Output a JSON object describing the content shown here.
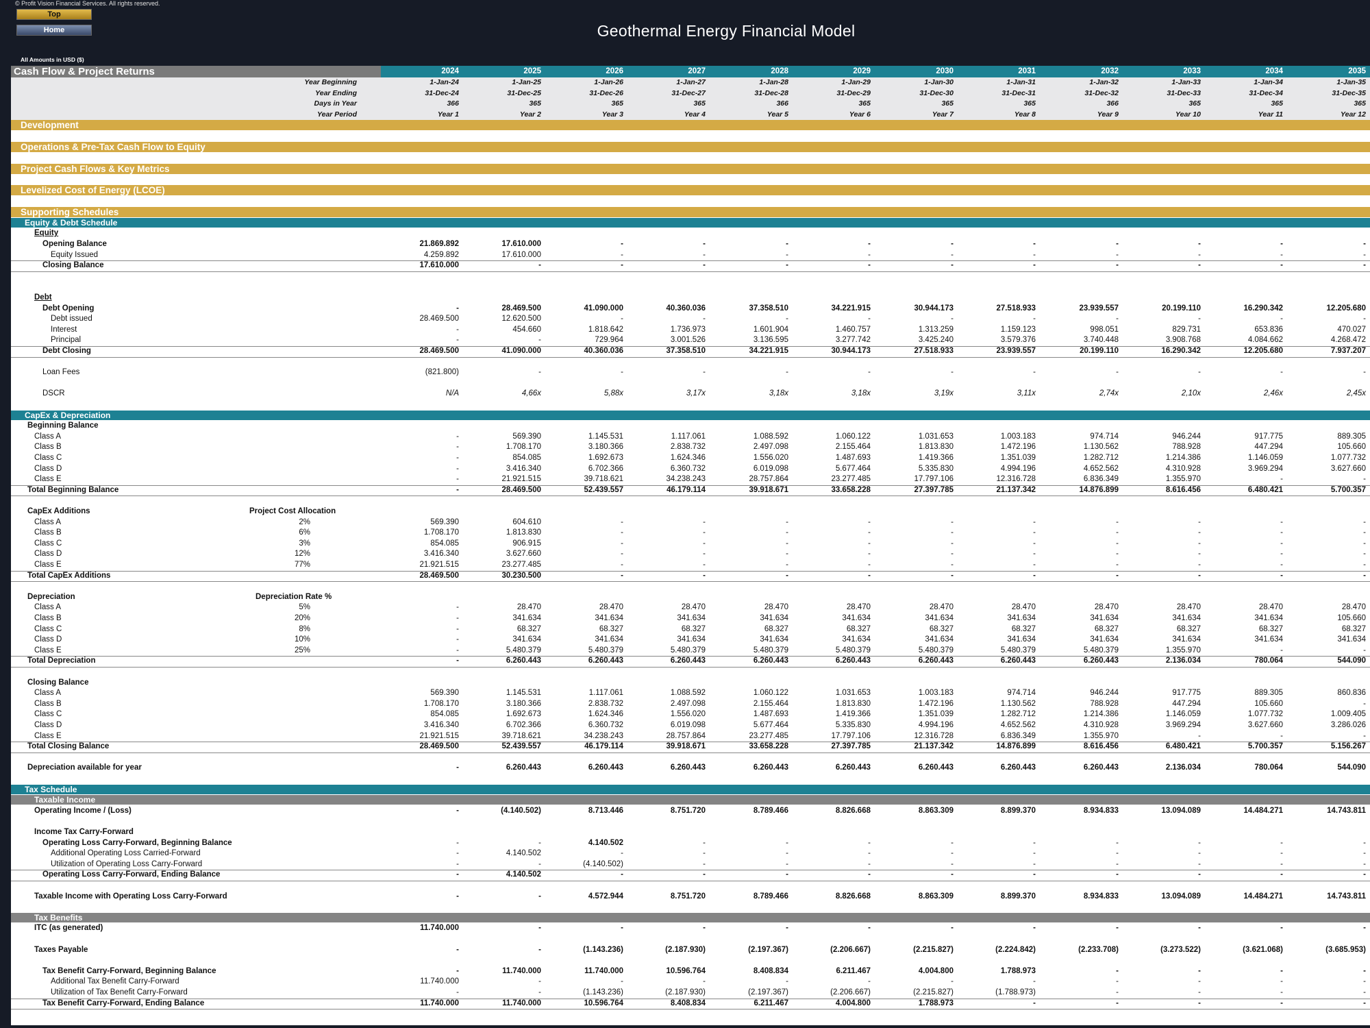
{
  "app": {
    "copyright": "© Profit Vision Financial Services. All rights reserved.",
    "top_label": "Top",
    "home_label": "Home",
    "title": "Geothermal Energy Financial Model",
    "amounts_note": "All Amounts in  USD ($)"
  },
  "header": {
    "title": "Cash Flow & Project Returns",
    "years": [
      "2024",
      "2025",
      "2026",
      "2027",
      "2028",
      "2029",
      "2030",
      "2031",
      "2032",
      "2033",
      "2034",
      "2035"
    ]
  },
  "rows": [
    {
      "type": "meta",
      "label": "Year Beginning",
      "vals": [
        "1-Jan-24",
        "1-Jan-25",
        "1-Jan-26",
        "1-Jan-27",
        "1-Jan-28",
        "1-Jan-29",
        "1-Jan-30",
        "1-Jan-31",
        "1-Jan-32",
        "1-Jan-33",
        "1-Jan-34",
        "1-Jan-35"
      ]
    },
    {
      "type": "meta",
      "label": "Year Ending",
      "vals": [
        "31-Dec-24",
        "31-Dec-25",
        "31-Dec-26",
        "31-Dec-27",
        "31-Dec-28",
        "31-Dec-29",
        "31-Dec-30",
        "31-Dec-31",
        "31-Dec-32",
        "31-Dec-33",
        "31-Dec-34",
        "31-Dec-35"
      ]
    },
    {
      "type": "meta",
      "label": "Days in Year",
      "vals": [
        "366",
        "365",
        "365",
        "365",
        "366",
        "365",
        "365",
        "365",
        "366",
        "365",
        "365",
        "365"
      ]
    },
    {
      "type": "meta",
      "label": "Year Period",
      "vals": [
        "Year 1",
        "Year 2",
        "Year 3",
        "Year 4",
        "Year 5",
        "Year 6",
        "Year 7",
        "Year 8",
        "Year 9",
        "Year 10",
        "Year 11",
        "Year 12"
      ]
    },
    {
      "type": "gold",
      "label": "Development"
    },
    {
      "type": "gap"
    },
    {
      "type": "gold",
      "label": "Operations & Pre-Tax Cash Flow to Equity"
    },
    {
      "type": "gap"
    },
    {
      "type": "gold",
      "label": "Project Cash Flows & Key Metrics"
    },
    {
      "type": "gap"
    },
    {
      "type": "gold",
      "label": "Levelized Cost of Energy (LCOE)"
    },
    {
      "type": "gap"
    },
    {
      "type": "gold",
      "label": "Supporting Schedules"
    },
    {
      "type": "teal",
      "label": "Equity & Debt Schedule"
    },
    {
      "type": "text",
      "label": "Equity",
      "x": 34,
      "b": true,
      "u": true
    },
    {
      "type": "data",
      "label": "Opening Balance",
      "x": 46,
      "b": true,
      "vals": [
        "21.869.892",
        "17.610.000",
        "-",
        "-",
        "-",
        "-",
        "-",
        "-",
        "-",
        "-",
        "-",
        "-"
      ]
    },
    {
      "type": "data",
      "label": "Equity Issued",
      "x": 58,
      "vals": [
        "4.259.892",
        "17.610.000",
        "-",
        "-",
        "-",
        "-",
        "-",
        "-",
        "-",
        "-",
        "-",
        "-"
      ]
    },
    {
      "type": "data",
      "label": "Closing Balance",
      "x": 46,
      "b": true,
      "bt": true,
      "vals": [
        "17.610.000",
        "-",
        "-",
        "-",
        "-",
        "-",
        "-",
        "-",
        "-",
        "-",
        "-",
        "-"
      ]
    },
    {
      "type": "gap"
    },
    {
      "type": "gap"
    },
    {
      "type": "text",
      "label": "Debt",
      "x": 34,
      "b": true,
      "u": true
    },
    {
      "type": "data",
      "label": "Debt Opening",
      "x": 46,
      "b": true,
      "vals": [
        "-",
        "28.469.500",
        "41.090.000",
        "40.360.036",
        "37.358.510",
        "34.221.915",
        "30.944.173",
        "27.518.933",
        "23.939.557",
        "20.199.110",
        "16.290.342",
        "12.205.680"
      ]
    },
    {
      "type": "data",
      "label": "Debt issued",
      "x": 58,
      "vals": [
        "28.469.500",
        "12.620.500",
        "-",
        "-",
        "-",
        "-",
        "-",
        "-",
        "-",
        "-",
        "-",
        "-"
      ]
    },
    {
      "type": "data",
      "label": "Interest",
      "x": 58,
      "vals": [
        "-",
        "454.660",
        "1.818.642",
        "1.736.973",
        "1.601.904",
        "1.460.757",
        "1.313.259",
        "1.159.123",
        "998.051",
        "829.731",
        "653.836",
        "470.027"
      ]
    },
    {
      "type": "data",
      "label": "Principal",
      "x": 58,
      "vals": [
        "-",
        "-",
        "729.964",
        "3.001.526",
        "3.136.595",
        "3.277.742",
        "3.425.240",
        "3.579.376",
        "3.740.448",
        "3.908.768",
        "4.084.662",
        "4.268.472"
      ]
    },
    {
      "type": "data",
      "label": "Debt Closing",
      "x": 46,
      "b": true,
      "bt": true,
      "vals": [
        "28.469.500",
        "41.090.000",
        "40.360.036",
        "37.358.510",
        "34.221.915",
        "30.944.173",
        "27.518.933",
        "23.939.557",
        "20.199.110",
        "16.290.342",
        "12.205.680",
        "7.937.207"
      ]
    },
    {
      "type": "gap"
    },
    {
      "type": "data",
      "label": "Loan Fees",
      "x": 46,
      "vals": [
        "(821.800)",
        "-",
        "-",
        "-",
        "-",
        "-",
        "-",
        "-",
        "-",
        "-",
        "-",
        "-"
      ]
    },
    {
      "type": "gap"
    },
    {
      "type": "data",
      "label": "DSCR",
      "x": 46,
      "i": true,
      "vals": [
        "N/A",
        "4,66x",
        "5,88x",
        "3,17x",
        "3,18x",
        "3,18x",
        "3,19x",
        "3,11x",
        "2,74x",
        "2,10x",
        "2,46x",
        "2,45x"
      ]
    },
    {
      "type": "gap"
    },
    {
      "type": "teal",
      "label": "CapEx & Depreciation"
    },
    {
      "type": "text",
      "label": "Beginning Balance",
      "x": 24,
      "b": true
    },
    {
      "type": "data",
      "label": "Class A",
      "x": 34,
      "vals": [
        "-",
        "569.390",
        "1.145.531",
        "1.117.061",
        "1.088.592",
        "1.060.122",
        "1.031.653",
        "1.003.183",
        "974.714",
        "946.244",
        "917.775",
        "889.305"
      ]
    },
    {
      "type": "data",
      "label": "Class B",
      "x": 34,
      "vals": [
        "-",
        "1.708.170",
        "3.180.366",
        "2.838.732",
        "2.497.098",
        "2.155.464",
        "1.813.830",
        "1.472.196",
        "1.130.562",
        "788.928",
        "447.294",
        "105.660"
      ]
    },
    {
      "type": "data",
      "label": "Class C",
      "x": 34,
      "vals": [
        "-",
        "854.085",
        "1.692.673",
        "1.624.346",
        "1.556.020",
        "1.487.693",
        "1.419.366",
        "1.351.039",
        "1.282.712",
        "1.214.386",
        "1.146.059",
        "1.077.732"
      ]
    },
    {
      "type": "data",
      "label": "Class D",
      "x": 34,
      "vals": [
        "-",
        "3.416.340",
        "6.702.366",
        "6.360.732",
        "6.019.098",
        "5.677.464",
        "5.335.830",
        "4.994.196",
        "4.652.562",
        "4.310.928",
        "3.969.294",
        "3.627.660"
      ]
    },
    {
      "type": "data",
      "label": "Class E",
      "x": 34,
      "vals": [
        "-",
        "21.921.515",
        "39.718.621",
        "34.238.243",
        "28.757.864",
        "23.277.485",
        "17.797.106",
        "12.316.728",
        "6.836.349",
        "1.355.970",
        "-",
        "-"
      ]
    },
    {
      "type": "data",
      "label": "Total Beginning Balance",
      "x": 24,
      "b": true,
      "bt": true,
      "vals": [
        "-",
        "28.469.500",
        "52.439.557",
        "46.179.114",
        "39.918.671",
        "33.658.228",
        "27.397.785",
        "21.137.342",
        "14.876.899",
        "8.616.456",
        "6.480.421",
        "5.700.357"
      ]
    },
    {
      "type": "gap"
    },
    {
      "type": "pct",
      "label": "CapEx Additions",
      "x": 24,
      "b": true,
      "mid": "Project Cost Allocation",
      "midb": true
    },
    {
      "type": "data",
      "label": "Class A",
      "x": 34,
      "mid": "2%",
      "vals": [
        "569.390",
        "604.610",
        "-",
        "-",
        "-",
        "-",
        "-",
        "-",
        "-",
        "-",
        "-",
        "-"
      ]
    },
    {
      "type": "data",
      "label": "Class B",
      "x": 34,
      "mid": "6%",
      "vals": [
        "1.708.170",
        "1.813.830",
        "-",
        "-",
        "-",
        "-",
        "-",
        "-",
        "-",
        "-",
        "-",
        "-"
      ]
    },
    {
      "type": "data",
      "label": "Class C",
      "x": 34,
      "mid": "3%",
      "vals": [
        "854.085",
        "906.915",
        "-",
        "-",
        "-",
        "-",
        "-",
        "-",
        "-",
        "-",
        "-",
        "-"
      ]
    },
    {
      "type": "data",
      "label": "Class D",
      "x": 34,
      "mid": "12%",
      "vals": [
        "3.416.340",
        "3.627.660",
        "-",
        "-",
        "-",
        "-",
        "-",
        "-",
        "-",
        "-",
        "-",
        "-"
      ]
    },
    {
      "type": "data",
      "label": "Class E",
      "x": 34,
      "mid": "77%",
      "vals": [
        "21.921.515",
        "23.277.485",
        "-",
        "-",
        "-",
        "-",
        "-",
        "-",
        "-",
        "-",
        "-",
        "-"
      ]
    },
    {
      "type": "data",
      "label": "Total CapEx Additions",
      "x": 24,
      "b": true,
      "bt": true,
      "vals": [
        "28.469.500",
        "30.230.500",
        "-",
        "-",
        "-",
        "-",
        "-",
        "-",
        "-",
        "-",
        "-",
        "-"
      ]
    },
    {
      "type": "gap"
    },
    {
      "type": "pct",
      "label": "Depreciation",
      "x": 24,
      "b": true,
      "mid": "Depreciation Rate %",
      "midb": true
    },
    {
      "type": "data",
      "label": "Class A",
      "x": 34,
      "mid": "5%",
      "vals": [
        "-",
        "28.470",
        "28.470",
        "28.470",
        "28.470",
        "28.470",
        "28.470",
        "28.470",
        "28.470",
        "28.470",
        "28.470",
        "28.470"
      ]
    },
    {
      "type": "data",
      "label": "Class B",
      "x": 34,
      "mid": "20%",
      "vals": [
        "-",
        "341.634",
        "341.634",
        "341.634",
        "341.634",
        "341.634",
        "341.634",
        "341.634",
        "341.634",
        "341.634",
        "341.634",
        "105.660"
      ]
    },
    {
      "type": "data",
      "label": "Class C",
      "x": 34,
      "mid": "8%",
      "vals": [
        "-",
        "68.327",
        "68.327",
        "68.327",
        "68.327",
        "68.327",
        "68.327",
        "68.327",
        "68.327",
        "68.327",
        "68.327",
        "68.327"
      ]
    },
    {
      "type": "data",
      "label": "Class D",
      "x": 34,
      "mid": "10%",
      "vals": [
        "-",
        "341.634",
        "341.634",
        "341.634",
        "341.634",
        "341.634",
        "341.634",
        "341.634",
        "341.634",
        "341.634",
        "341.634",
        "341.634"
      ]
    },
    {
      "type": "data",
      "label": "Class E",
      "x": 34,
      "mid": "25%",
      "vals": [
        "-",
        "5.480.379",
        "5.480.379",
        "5.480.379",
        "5.480.379",
        "5.480.379",
        "5.480.379",
        "5.480.379",
        "5.480.379",
        "1.355.970",
        "-",
        "-"
      ]
    },
    {
      "type": "data",
      "label": "Total Depreciation",
      "x": 24,
      "b": true,
      "bt": true,
      "vals": [
        "-",
        "6.260.443",
        "6.260.443",
        "6.260.443",
        "6.260.443",
        "6.260.443",
        "6.260.443",
        "6.260.443",
        "6.260.443",
        "2.136.034",
        "780.064",
        "544.090"
      ]
    },
    {
      "type": "gap"
    },
    {
      "type": "text",
      "label": "Closing Balance",
      "x": 24,
      "b": true
    },
    {
      "type": "data",
      "label": "Class A",
      "x": 34,
      "vals": [
        "569.390",
        "1.145.531",
        "1.117.061",
        "1.088.592",
        "1.060.122",
        "1.031.653",
        "1.003.183",
        "974.714",
        "946.244",
        "917.775",
        "889.305",
        "860.836"
      ]
    },
    {
      "type": "data",
      "label": "Class B",
      "x": 34,
      "vals": [
        "1.708.170",
        "3.180.366",
        "2.838.732",
        "2.497.098",
        "2.155.464",
        "1.813.830",
        "1.472.196",
        "1.130.562",
        "788.928",
        "447.294",
        "105.660",
        "-"
      ]
    },
    {
      "type": "data",
      "label": "Class C",
      "x": 34,
      "vals": [
        "854.085",
        "1.692.673",
        "1.624.346",
        "1.556.020",
        "1.487.693",
        "1.419.366",
        "1.351.039",
        "1.282.712",
        "1.214.386",
        "1.146.059",
        "1.077.732",
        "1.009.405"
      ]
    },
    {
      "type": "data",
      "label": "Class D",
      "x": 34,
      "vals": [
        "3.416.340",
        "6.702.366",
        "6.360.732",
        "6.019.098",
        "5.677.464",
        "5.335.830",
        "4.994.196",
        "4.652.562",
        "4.310.928",
        "3.969.294",
        "3.627.660",
        "3.286.026"
      ]
    },
    {
      "type": "data",
      "label": "Class E",
      "x": 34,
      "vals": [
        "21.921.515",
        "39.718.621",
        "34.238.243",
        "28.757.864",
        "23.277.485",
        "17.797.106",
        "12.316.728",
        "6.836.349",
        "1.355.970",
        "-",
        "-",
        "-"
      ]
    },
    {
      "type": "data",
      "label": "Total Closing Balance",
      "x": 24,
      "b": true,
      "bt": true,
      "vals": [
        "28.469.500",
        "52.439.557",
        "46.179.114",
        "39.918.671",
        "33.658.228",
        "27.397.785",
        "21.137.342",
        "14.876.899",
        "8.616.456",
        "6.480.421",
        "5.700.357",
        "5.156.267"
      ]
    },
    {
      "type": "gap"
    },
    {
      "type": "data",
      "label": "Depreciation available for year",
      "x": 24,
      "b": true,
      "vals": [
        "-",
        "6.260.443",
        "6.260.443",
        "6.260.443",
        "6.260.443",
        "6.260.443",
        "6.260.443",
        "6.260.443",
        "6.260.443",
        "2.136.034",
        "780.064",
        "544.090"
      ]
    },
    {
      "type": "gap"
    },
    {
      "type": "teal",
      "label": "Tax Schedule"
    },
    {
      "type": "grey",
      "label": "Taxable Income"
    },
    {
      "type": "data",
      "label": "Operating Income / (Loss)",
      "x": 34,
      "b": true,
      "vals": [
        "-",
        "(4.140.502)",
        "8.713.446",
        "8.751.720",
        "8.789.466",
        "8.826.668",
        "8.863.309",
        "8.899.370",
        "8.934.833",
        "13.094.089",
        "14.484.271",
        "14.743.811"
      ]
    },
    {
      "type": "gap"
    },
    {
      "type": "text",
      "label": "Income Tax Carry-Forward",
      "x": 34,
      "b": true
    },
    {
      "type": "data",
      "label": "Operating Loss Carry-Forward, Beginning Balance",
      "x": 46,
      "b": true,
      "vals": [
        "-",
        "-",
        "4.140.502",
        "-",
        "-",
        "-",
        "-",
        "-",
        "-",
        "-",
        "-",
        "-"
      ],
      "vb": [
        false,
        false,
        true,
        false,
        false,
        false,
        false,
        false,
        false,
        false,
        false,
        false
      ]
    },
    {
      "type": "data",
      "label": "Additional Operating Loss Carried-Forward",
      "x": 58,
      "vals": [
        "-",
        "4.140.502",
        "-",
        "-",
        "-",
        "-",
        "-",
        "-",
        "-",
        "-",
        "-",
        "-"
      ]
    },
    {
      "type": "data",
      "label": "Utilization of Operating Loss Carry-Forward",
      "x": 58,
      "vals": [
        "-",
        "-",
        "(4.140.502)",
        "-",
        "-",
        "-",
        "-",
        "-",
        "-",
        "-",
        "-",
        "-"
      ]
    },
    {
      "type": "data",
      "label": "Operating Loss Carry-Forward, Ending Balance",
      "x": 46,
      "b": true,
      "bt": true,
      "vals": [
        "-",
        "4.140.502",
        "-",
        "-",
        "-",
        "-",
        "-",
        "-",
        "-",
        "-",
        "-",
        "-"
      ]
    },
    {
      "type": "gap"
    },
    {
      "type": "data",
      "label": "Taxable Income with Operating Loss Carry-Forward",
      "x": 34,
      "b": true,
      "vals": [
        "-",
        "-",
        "4.572.944",
        "8.751.720",
        "8.789.466",
        "8.826.668",
        "8.863.309",
        "8.899.370",
        "8.934.833",
        "13.094.089",
        "14.484.271",
        "14.743.811"
      ]
    },
    {
      "type": "gap"
    },
    {
      "type": "grey",
      "label": "Tax Benefits"
    },
    {
      "type": "data",
      "label": "ITC (as generated)",
      "x": 34,
      "b": true,
      "vals": [
        "11.740.000",
        "-",
        "-",
        "-",
        "-",
        "-",
        "-",
        "-",
        "-",
        "-",
        "-",
        "-"
      ]
    },
    {
      "type": "gap"
    },
    {
      "type": "data",
      "label": "Taxes Payable",
      "x": 34,
      "b": true,
      "vals": [
        "-",
        "-",
        "(1.143.236)",
        "(2.187.930)",
        "(2.197.367)",
        "(2.206.667)",
        "(2.215.827)",
        "(2.224.842)",
        "(2.233.708)",
        "(3.273.522)",
        "(3.621.068)",
        "(3.685.953)"
      ]
    },
    {
      "type": "gap"
    },
    {
      "type": "data",
      "label": "Tax Benefit Carry-Forward, Beginning Balance",
      "x": 46,
      "b": true,
      "vals": [
        "-",
        "11.740.000",
        "11.740.000",
        "10.596.764",
        "8.408.834",
        "6.211.467",
        "4.004.800",
        "1.788.973",
        "-",
        "-",
        "-",
        "-"
      ]
    },
    {
      "type": "data",
      "label": "Additional Tax Benefit Carry-Forward",
      "x": 58,
      "vals": [
        "11.740.000",
        "-",
        "-",
        "-",
        "-",
        "-",
        "-",
        "-",
        "-",
        "-",
        "-",
        "-"
      ]
    },
    {
      "type": "data",
      "label": "Utilization of Tax Benefit Carry-Forward",
      "x": 58,
      "vals": [
        "-",
        "-",
        "(1.143.236)",
        "(2.187.930)",
        "(2.197.367)",
        "(2.206.667)",
        "(2.215.827)",
        "(1.788.973)",
        "-",
        "-",
        "-",
        "-"
      ]
    },
    {
      "type": "data",
      "label": "Tax Benefit Carry-Forward, Ending Balance",
      "x": 46,
      "b": true,
      "bt": true,
      "vals": [
        "11.740.000",
        "11.740.000",
        "10.596.764",
        "8.408.834",
        "6.211.467",
        "4.004.800",
        "1.788.973",
        "-",
        "-",
        "-",
        "-",
        "-"
      ]
    }
  ]
}
